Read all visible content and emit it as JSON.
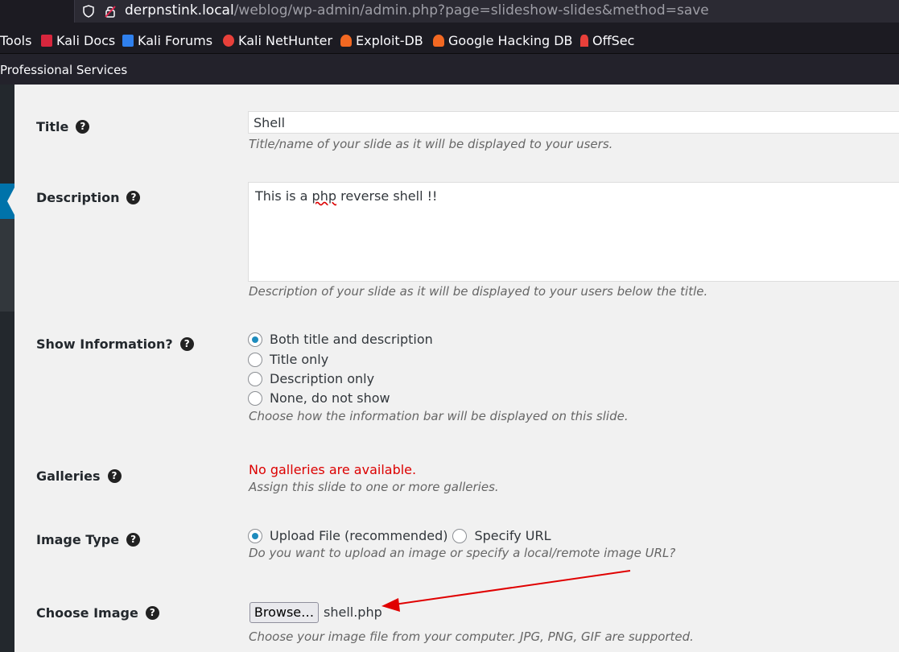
{
  "browser": {
    "url_host": "derpnstink.local",
    "url_path": "/weblog/wp-admin/admin.php?page=slideshow-slides&method=save",
    "bookmarks": [
      "Tools",
      "Kali Docs",
      "Kali Forums",
      "Kali NetHunter",
      "Exploit-DB",
      "Google Hacking DB",
      "OffSec"
    ],
    "toolbar_text": "Professional Services"
  },
  "form": {
    "title": {
      "label": "Title",
      "value": "Shell",
      "hint": "Title/name of your slide as it will be displayed to your users."
    },
    "description": {
      "label": "Description",
      "value_pre": "This is a ",
      "value_misspelled": "php",
      "value_post": " reverse shell !!",
      "hint": "Description of your slide as it will be displayed to your users below the title."
    },
    "show_information": {
      "label": "Show Information?",
      "options": [
        "Both title and description",
        "Title only",
        "Description only",
        "None, do not show"
      ],
      "selected": "Both title and description",
      "hint": "Choose how the information bar will be displayed on this slide."
    },
    "galleries": {
      "label": "Galleries",
      "error": "No galleries are available.",
      "hint": "Assign this slide to one or more galleries."
    },
    "image_type": {
      "label": "Image Type",
      "options": [
        "Upload File (recommended)",
        "Specify URL"
      ],
      "selected": "Upload File (recommended)",
      "hint": "Do you want to upload an image or specify a local/remote image URL?"
    },
    "choose_image": {
      "label": "Choose Image",
      "browse_label": "Browse…",
      "filename": "shell.php",
      "hint": "Choose your image file from your computer. JPG, PNG, GIF are supported."
    }
  },
  "help_icon_char": "?",
  "colors": {
    "error": "#dc0000",
    "radio_checked": "#1e8cbe",
    "annotation_arrow": "#e00000",
    "wp_active": "#0073aa"
  }
}
